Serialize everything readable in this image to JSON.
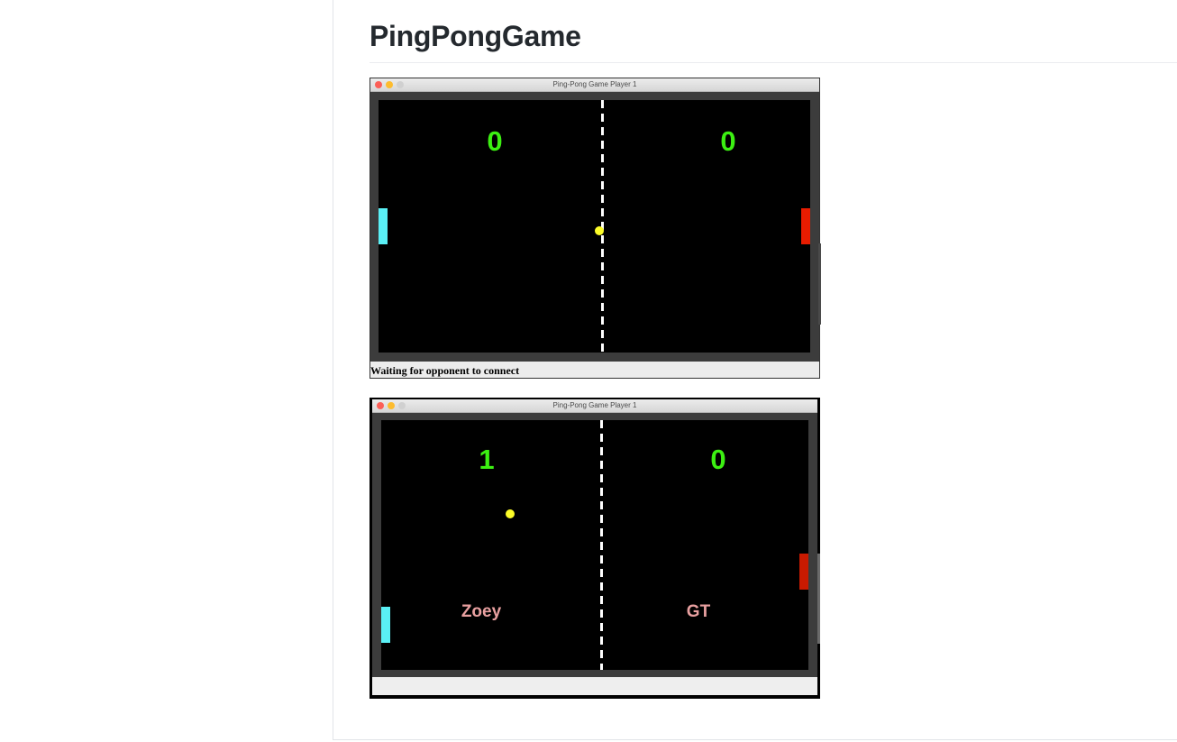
{
  "page": {
    "title": "PingPongGame"
  },
  "window1": {
    "title": "Ping-Pong Game Player 1",
    "score_left": "0",
    "score_right": "0",
    "status": "Waiting for opponent to connect"
  },
  "window2": {
    "title": "Ping-Pong Game Player 1",
    "score_left": "1",
    "score_right": "0",
    "player_left": "Zoey",
    "player_right": "GT",
    "status": ""
  },
  "colors": {
    "score": "#3cf012",
    "left_paddle": "#5af0f5",
    "right_paddle": "#e81c00",
    "ball": "#fcfc28",
    "player_name": "#e8a0a0"
  },
  "icons": [
    "close-light-icon",
    "minimize-light-icon",
    "zoom-light-icon"
  ]
}
